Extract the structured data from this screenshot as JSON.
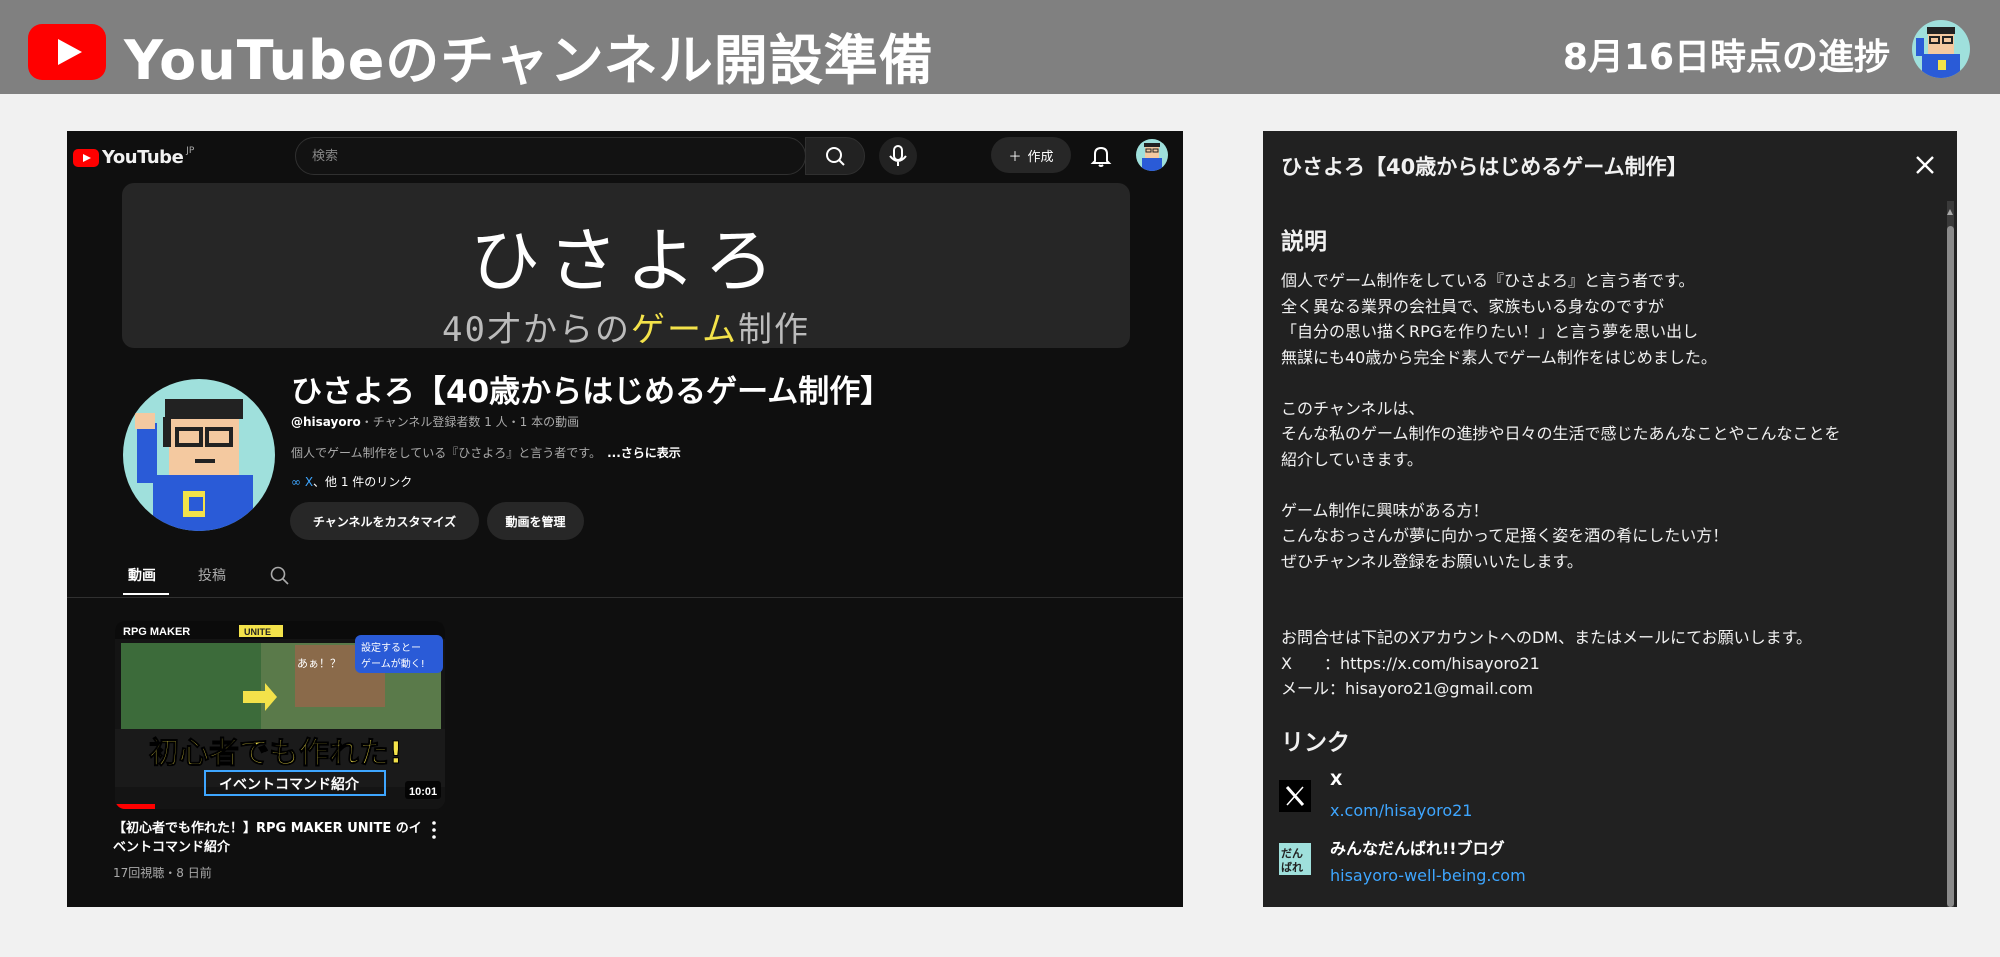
{
  "header": {
    "title": "YouTubeのチャンネル開設準備",
    "progress": "8月16日時点の進捗"
  },
  "youtube": {
    "logo_text": "YouTube",
    "region": "JP",
    "search_placeholder": "検索",
    "create_label": "作成",
    "banner": {
      "line1": "ひさよろ",
      "line2_a": "40才からの",
      "line2_hl": "ゲーム",
      "line2_b": "制作"
    },
    "channel": {
      "name": "ひさよろ【40歳からはじめるゲーム制作】",
      "handle": "@hisayoro",
      "stats": "・チャンネル登録者数 1 人・1 本の動画",
      "description": "個人でゲーム制作をしている『ひさよろ』と言う者です。",
      "more": "...さらに表示",
      "link_x": "X",
      "link_rest": "、他 1 件のリンク",
      "customize_button": "チャンネルをカスタマイズ",
      "manage_button": "動画を管理"
    },
    "tabs": [
      "動画",
      "投稿"
    ],
    "video": {
      "thumb_brand": "RPG MAKER",
      "thumb_unite": "UNITE",
      "thumb_bubble1": "設定するとー",
      "thumb_bubble2": "ゲームが動く!",
      "thumb_speech": "あぁ！？",
      "thumb_big": "初心者でも作れた!",
      "thumb_sub": "イベントコマンド紹介",
      "duration": "10:01",
      "title": "【初心者でも作れた！】RPG MAKER UNITE のイベントコマンド紹介",
      "meta": "17回視聴・8 日前"
    }
  },
  "about": {
    "title": "ひさよろ【40歳からはじめるゲーム制作】",
    "description_heading": "説明",
    "description": "個人でゲーム制作をしている『ひさよろ』と言う者です。\n全く異なる業界の会社員で、家族もいる身なのですが\n「自分の思い描くRPGを作りたい！」と言う夢を思い出し\n無謀にも40歳から完全ド素人でゲーム制作をはじめました。\n\nこのチャンネルは、\nそんな私のゲーム制作の進捗や日々の生活で感じたあんなことやこんなことを\n紹介していきます。\n\nゲーム制作に興味がある方！\nこんなおっさんが夢に向かって足掻く姿を酒の肴にしたい方！\nぜひチャンネル登録をお願いいたします。\n\n\nお問合せは下記のXアカウントへのDM、またはメールにてお願いします。\nX　　：https://x.com/hisayoro21\nメール：hisayoro21@gmail.com",
    "links_heading": "リンク",
    "links": [
      {
        "name": "X",
        "url": "x.com/hisayoro21",
        "icon": "x-logo-icon"
      },
      {
        "name": "みんなだんばれ!!ブログ",
        "url": "hisayoro-well-being.com",
        "icon": "blog-logo-icon",
        "icon_text": "だん ばれ"
      }
    ]
  },
  "colors": {
    "yt_red": "#ff0000",
    "link_blue": "#3ea6ff",
    "banner_yellow": "#f3e24a",
    "avatar_bg": "#9fe0dc"
  }
}
